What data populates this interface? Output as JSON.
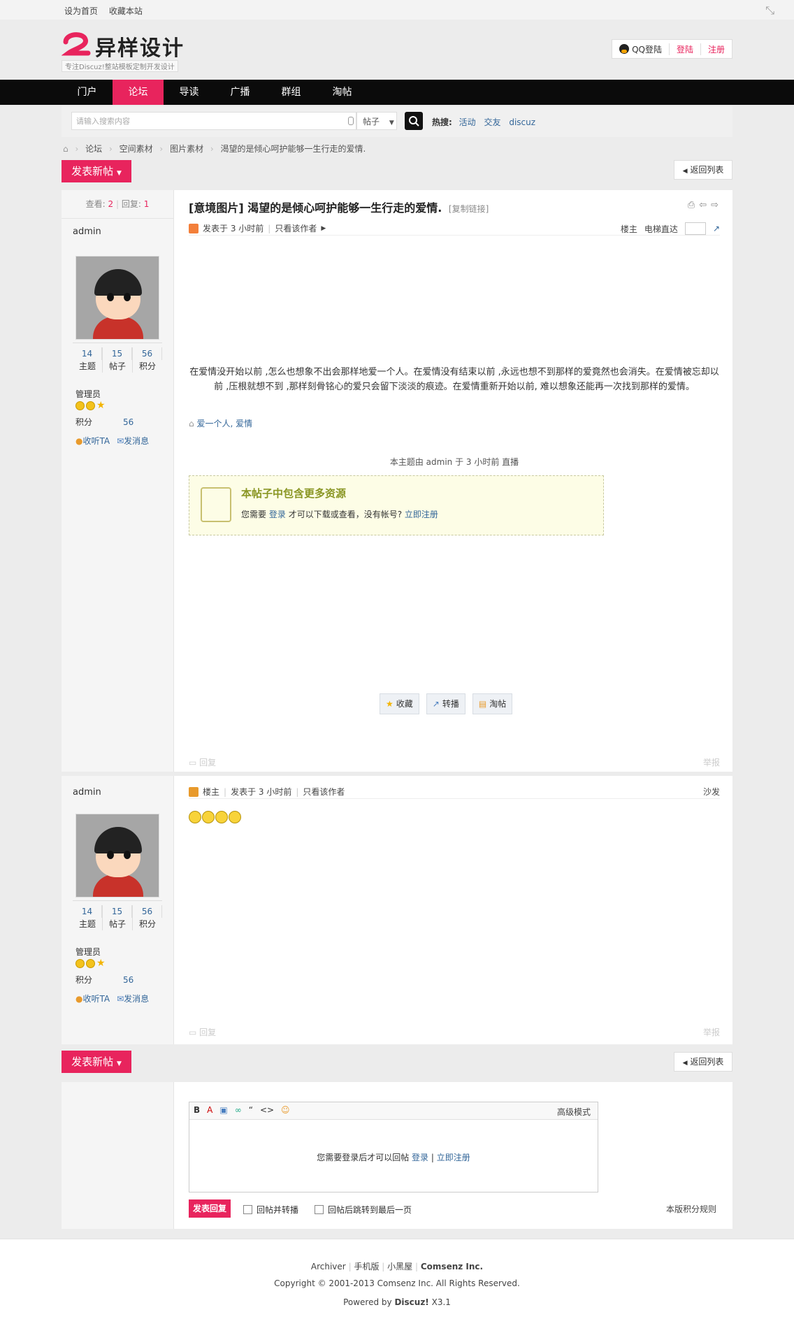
{
  "topbar": {
    "set_home": "设为首页",
    "bookmark": "收藏本站"
  },
  "logo": {
    "title": "异样设计",
    "slogan": "专注Discuz!整站模板定制开发设计"
  },
  "login": {
    "qq": "QQ登陆",
    "login": "登陆",
    "register": "注册"
  },
  "nav": [
    "门户",
    "论坛",
    "导读",
    "广播",
    "群组",
    "淘帖"
  ],
  "search": {
    "placeholder": "请输入搜索内容",
    "type": "帖子",
    "hot_label": "热搜:",
    "hot": [
      "活动",
      "交友",
      "discuz"
    ]
  },
  "breadcrumb": [
    "论坛",
    "空间素材",
    "图片素材",
    "渴望的是倾心呵护能够一生行走的爱情."
  ],
  "post_button": "发表新帖",
  "back_button": "返回列表",
  "thread": {
    "views_label": "查看:",
    "views": "2",
    "replies_label": "回复:",
    "replies": "1",
    "category": "[意境图片]",
    "title": "渴望的是倾心呵护能够一生行走的爱情.",
    "copy_link": "[复制链接]"
  },
  "user": {
    "name": "admin",
    "topics": "14",
    "topics_label": "主题",
    "posts": "15",
    "posts_label": "帖子",
    "credits": "56",
    "credits_label": "积分",
    "role": "管理员",
    "credit_label": "积分",
    "listen": "收听TA",
    "message": "发消息"
  },
  "post1": {
    "posted": "发表于 3 小时前",
    "only_author": "只看该作者",
    "floor": "楼主",
    "jump": "电梯直达",
    "content": "在爱情没开始以前 ,怎么也想象不出会那样地爱一个人。在爱情没有结束以前 ,永远也想不到那样的爱竟然也会消失。在爱情被忘却以前 ,压根就想不到 ,那样刻骨铭心的爱只会留下淡淡的痕迹。在爱情重新开始以前, 难以想象还能再一次找到那样的爱情。",
    "tags": "爱一个人, 爱情",
    "note": "本主题由 admin 于 3 小时前 直播",
    "locked_title": "本帖子中包含更多资源",
    "locked_desc_pre": "您需要",
    "locked_login": "登录",
    "locked_desc_mid": "才可以下载或查看，没有帐号?",
    "locked_register": "立即注册",
    "fav": "收藏",
    "share": "转播",
    "collect": "淘帖",
    "reply": "回复",
    "report": "举报"
  },
  "post2": {
    "floor": "楼主",
    "posted": "发表于 3 小时前",
    "only_author": "只看该作者",
    "seat": "沙发",
    "reply": "回复",
    "report": "举报"
  },
  "editor": {
    "bold": "B",
    "quote": "“",
    "code": "<>",
    "advanced": "高级模式",
    "msg_pre": "您需要登录后才可以回帖",
    "login": "登录",
    "sep": "|",
    "register": "立即注册",
    "reply_btn": "发表回复",
    "opt1": "回帖并转播",
    "opt2": "回帖后跳转到最后一页",
    "rules": "本版积分规则"
  },
  "footer": {
    "links": [
      "Archiver",
      "手机版",
      "小黑屋"
    ],
    "company": "Comsenz Inc.",
    "copyright": "Copyright © 2001-2013 Comsenz Inc.   All Rights Reserved.",
    "powered_pre": "Powered by",
    "powered_brand": "Discuz!",
    "powered_ver": "X3.1"
  }
}
